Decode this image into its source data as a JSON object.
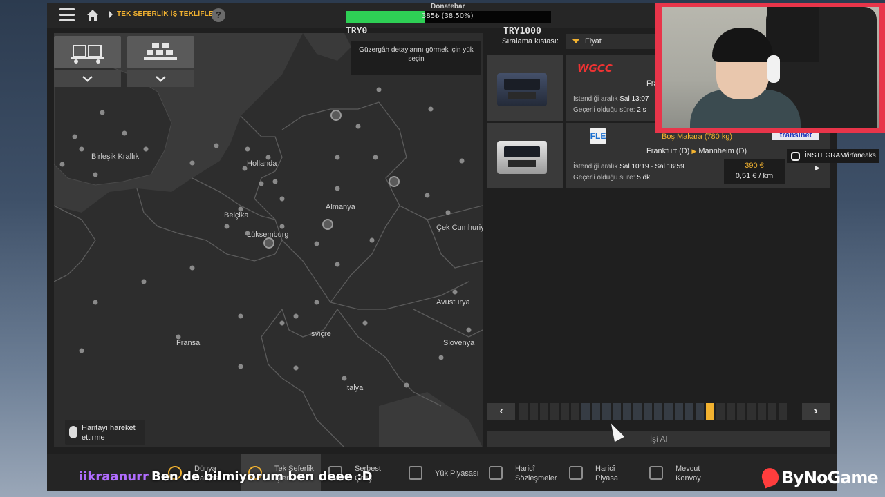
{
  "header": {
    "breadcrumb": "TEK SEFERLİK İŞ TEKLİFLERİ",
    "help": "?"
  },
  "donation": {
    "title": "Donatebar",
    "progress_text": "385₺ (38.50%)",
    "progress_fraction": 0.385,
    "min_label": "TRY0",
    "max_label": "TRY1000",
    "fill_color": "#2ecf55"
  },
  "map": {
    "tooltip": "Güzergâh detaylarını görmek için yük seçin",
    "hint": "Haritayı hareket ettirme",
    "labels": {
      "uk": "Birleşik Krallık",
      "netherlands": "Hollanda",
      "belgium": "Belçika",
      "luxembourg": "Lüksemburg",
      "germany": "Almanya",
      "czech": "Çek Cumhuriy",
      "austria": "Avusturya",
      "switzerland": "İsviçre",
      "slovenia": "Slovenya",
      "france": "Fransa",
      "italy": "İtalya"
    },
    "filter_icons": [
      "truck-fleet-icon",
      "cargo-pallets-icon"
    ]
  },
  "sort": {
    "label": "Sıralama kıstası:",
    "value": "Fiyat"
  },
  "jobs": [
    {
      "company": "WGCC",
      "route_partial": "Fra",
      "window_label": "İstendiği aralık",
      "window_value": "Sal 13:07",
      "validity_label": "Geçerli olduğu süre:",
      "validity_value": "2 s"
    },
    {
      "company_logo": "FLE",
      "cargo": "Boş Makara (780 kg)",
      "recipient": "transinet",
      "from": "Frankfurt (D)",
      "to": "Mannheim (D)",
      "window_label": "İstendiği aralık",
      "window_value": "Sal 10:19 - Sal 16:59",
      "validity_label": "Geçerli olduğu süre:",
      "validity_value": "5 dk.",
      "price": "390 €",
      "rate": "0,51 € / km"
    }
  ],
  "pager": {
    "prev": "‹",
    "next": "›",
    "pages": 26,
    "active_index": 18
  },
  "take_job": "İşi Al",
  "nav": [
    {
      "icon": "world-icon",
      "label": "Dünya\nHaritası",
      "active": false
    },
    {
      "icon": "clock-icon",
      "label": "Tek Seferlik\nİşler",
      "active": true
    },
    {
      "icon": "freight-icon",
      "label": "Serbest\nÇalış",
      "active": false
    },
    {
      "icon": "cargo-market-icon",
      "label": "Yük Piyasası",
      "active": false
    },
    {
      "icon": "contracts-icon",
      "label": "Haricî\nSözleşmeler",
      "active": false
    },
    {
      "icon": "external-market-icon",
      "label": "Haricî\nPiyasa",
      "active": false
    },
    {
      "icon": "convoy-icon",
      "label": "Mevcut\nKonvoy",
      "active": false
    }
  ],
  "stream": {
    "instagram": "İNSTEGRAM/irfaneaks",
    "chat_user": "iikraanurr",
    "chat_message": "Ben de bilmiyorum ben deee :D",
    "brand": "ByNoGame",
    "accent": "#f2b230"
  }
}
